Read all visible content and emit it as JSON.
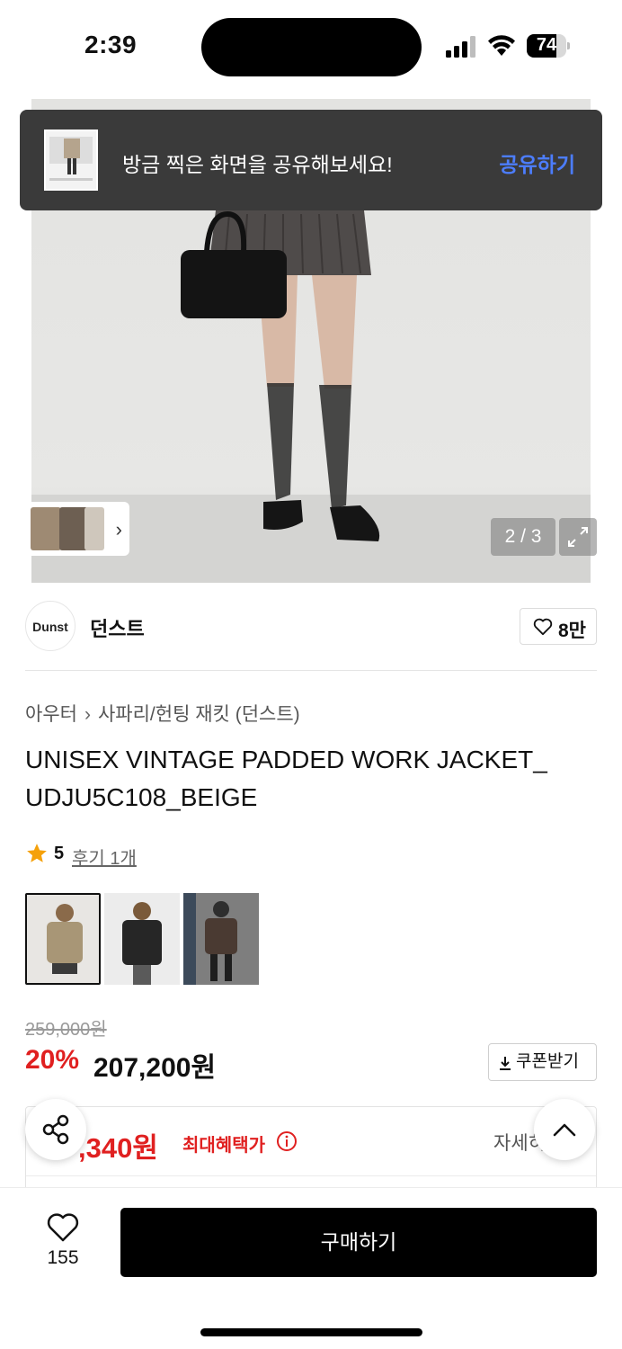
{
  "status_bar": {
    "time": "2:39",
    "battery": "74",
    "battery_level": 0.74
  },
  "toast": {
    "message": "방금 찍은 화면을 공유해보세요!",
    "action": "공유하기"
  },
  "gallery": {
    "page_indicator": "2 / 3"
  },
  "brand": {
    "logo_text": "Dunst",
    "name": "던스트",
    "likes": "8만"
  },
  "breadcrumb": {
    "category": "아우터",
    "subcategory": "사파리/헌팅 재킷 (던스트)"
  },
  "product": {
    "title": "UNISEX VINTAGE PADDED WORK JACKET_ UDJU5C108_BEIGE",
    "rating": "5",
    "reviews": "후기 1개",
    "original_price": "259,000원",
    "discount": "20%",
    "sale_price": "207,200원",
    "coupon_label": "쿠폰받기"
  },
  "benefit": {
    "price": ",340원",
    "label": "최대혜택가",
    "detail": "자세히"
  },
  "bottom_bar": {
    "wish_count": "155",
    "buy_label": "구매하기"
  },
  "colors": {
    "accent_red": "#e02020",
    "toast_action_blue": "#4c7dff",
    "buy_button": "#000000"
  }
}
